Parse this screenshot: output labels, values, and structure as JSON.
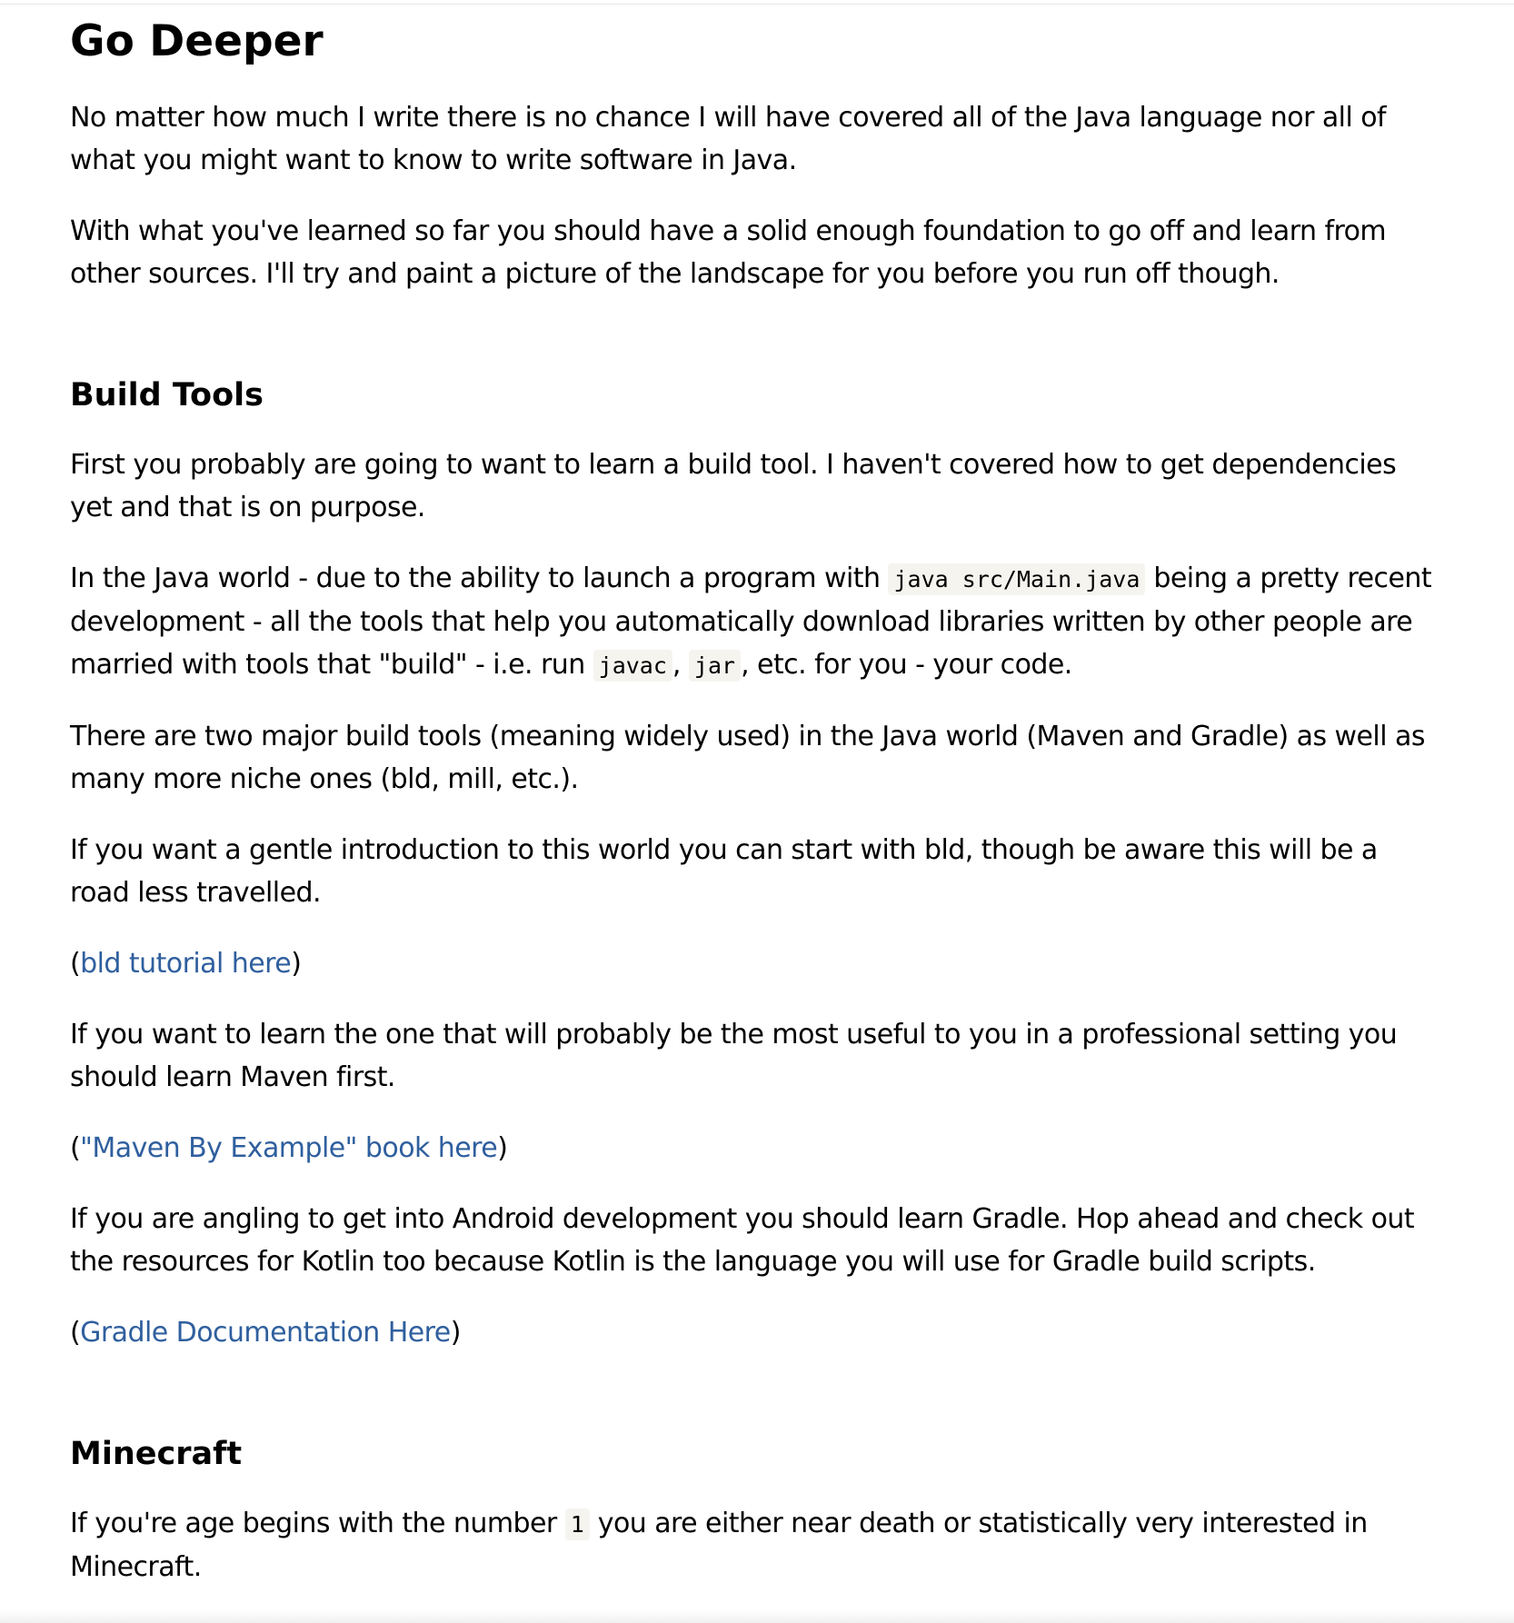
{
  "heading": "Go Deeper",
  "intro": {
    "p1": "No matter how much I write there is no chance I will have covered all of the Java language nor all of what you might want to know to write software in Java.",
    "p2": "With what you've learned so far you should have a solid enough foundation to go off and learn from other sources. I'll try and paint a picture of the landscape for you before you run off though."
  },
  "build_tools": {
    "heading": "Build Tools",
    "p1": "First you probably are going to want to learn a build tool. I haven't covered how to get dependencies yet and that is on purpose.",
    "p2": {
      "a": "In the Java world - due to the ability to launch a program with ",
      "code1": "java src/Main.java",
      "b": " being a pretty recent development - all the tools that help you automatically download libraries written by other people are married with tools that \"build\" - i.e. run ",
      "code2": "javac",
      "c": ", ",
      "code3": "jar",
      "d": ", etc. for you - your code."
    },
    "p3": "There are two major build tools (meaning widely used) in the Java world (Maven and Gradle) as well as many more niche ones (bld, mill, etc.).",
    "p4": "If you want a gentle introduction to this world you can start with bld, though be aware this will be a road less travelled.",
    "link1": {
      "open": "(",
      "text": "bld tutorial here",
      "close": ")"
    },
    "p5": "If you want to learn the one that will probably be the most useful to you in a professional setting you should learn Maven first.",
    "link2": {
      "open": "(",
      "text": "\"Maven By Example\" book here",
      "close": ")"
    },
    "p6": "If you are angling to get into Android development you should learn Gradle. Hop ahead and check out the resources for Kotlin too because Kotlin is the language you will use for Gradle build scripts.",
    "link3": {
      "open": "(",
      "text": "Gradle Documentation Here",
      "close": ")"
    }
  },
  "minecraft": {
    "heading": "Minecraft",
    "p1": {
      "a": "If you're age begins with the number ",
      "code": "1",
      "b": " you are either near death or statistically very interested in Minecraft."
    }
  },
  "colors": {
    "link": "#2f5f9e",
    "code_bg": "#f6f4ef",
    "text": "#000000"
  }
}
